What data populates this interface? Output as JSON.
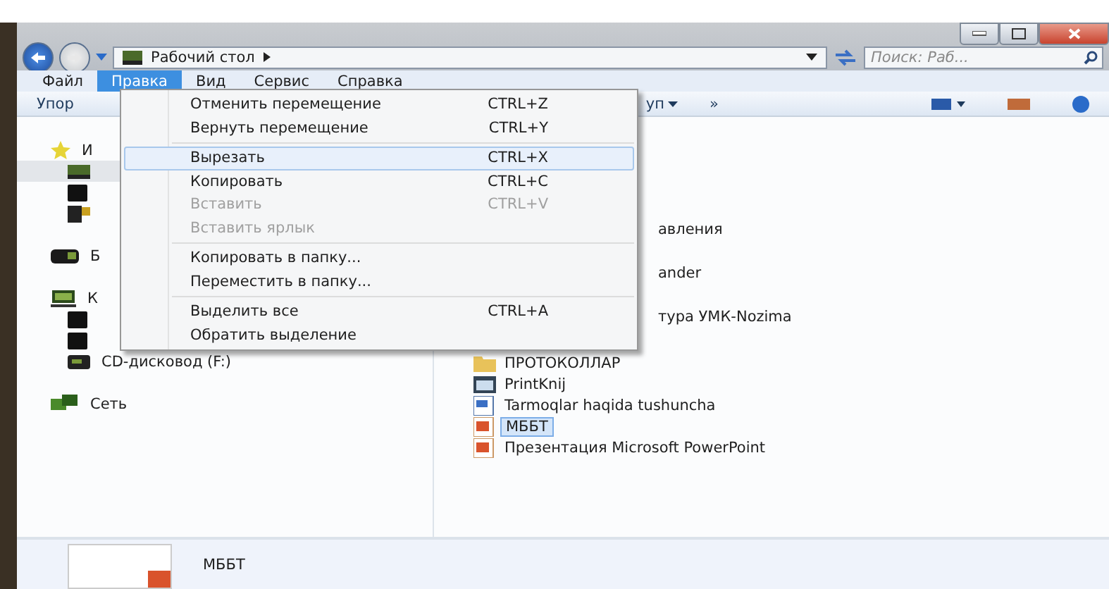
{
  "address_bar": {
    "path": "Рабочий стол",
    "search_placeholder": "Поиск: Раб..."
  },
  "menu_bar": [
    {
      "label": "Файл",
      "selected": false
    },
    {
      "label": "Правка",
      "selected": true
    },
    {
      "label": "Вид",
      "selected": false
    },
    {
      "label": "Сервис",
      "selected": false
    },
    {
      "label": "Справка",
      "selected": false
    }
  ],
  "toolbar": {
    "left": "Упор",
    "middle": "уп",
    "overflow": "»"
  },
  "edit_menu": [
    {
      "kind": "item",
      "label": "Отменить перемещение",
      "shortcut": "CTRL+Z",
      "disabled": false,
      "selected": false
    },
    {
      "kind": "item",
      "label": "Вернуть перемещение",
      "shortcut": "CTRL+Y",
      "disabled": false,
      "selected": false
    },
    {
      "kind": "separator"
    },
    {
      "kind": "item",
      "label": "Вырезать",
      "shortcut": "CTRL+X",
      "disabled": false,
      "selected": true
    },
    {
      "kind": "item",
      "label": "Копировать",
      "shortcut": "CTRL+C",
      "disabled": false,
      "selected": false
    },
    {
      "kind": "item",
      "label": "Вставить",
      "shortcut": "CTRL+V",
      "disabled": true,
      "selected": false
    },
    {
      "kind": "item",
      "label": "Вставить ярлык",
      "disabled": true,
      "selected": false
    },
    {
      "kind": "separator"
    },
    {
      "kind": "item",
      "label": "Копировать в папку...",
      "disabled": false,
      "selected": false
    },
    {
      "kind": "item",
      "label": "Переместить в папку...",
      "disabled": false,
      "selected": false
    },
    {
      "kind": "separator"
    },
    {
      "kind": "item",
      "label": "Выделить все",
      "shortcut": "CTRL+A",
      "disabled": false,
      "selected": false
    },
    {
      "kind": "item",
      "label": "Обратить выделение",
      "disabled": false,
      "selected": false
    }
  ],
  "navigation": [
    {
      "kind": "favorites",
      "label": "И",
      "selected": false,
      "children": [
        {
          "kind": "desktop",
          "selected": true
        },
        {
          "kind": "drive",
          "selected": false
        },
        {
          "kind": "places",
          "selected": false
        }
      ]
    },
    {
      "kind": "library",
      "label": "Б",
      "selected": false
    },
    {
      "kind": "computer",
      "label": "К",
      "selected": false,
      "children": [
        {
          "kind": "drive",
          "selected": false
        },
        {
          "kind": "drive",
          "selected": false
        },
        {
          "kind": "cd",
          "label": "CD-дисковод (F:)",
          "selected": false
        }
      ]
    },
    {
      "kind": "network",
      "label": "Сеть",
      "selected": false
    }
  ],
  "files": [
    {
      "kind": "covered",
      "label": "авления",
      "selected": false
    },
    {
      "kind": "covered",
      "label": "ander",
      "selected": false
    },
    {
      "kind": "covered",
      "label": "тура УМК-Nozima",
      "selected": false
    },
    {
      "kind": "folder",
      "label": "ПРОТОКОЛЛАР",
      "selected": false
    },
    {
      "kind": "app",
      "label": "PrintKnij",
      "selected": false
    },
    {
      "kind": "doc",
      "label": "Tarmoqlar haqida tushuncha",
      "selected": false
    },
    {
      "kind": "ppt",
      "label": "МББТ",
      "selected": true
    },
    {
      "kind": "ppt",
      "label": "Презентация Microsoft PowerPoint",
      "selected": false
    }
  ],
  "details_pane": {
    "name": "МББТ"
  }
}
